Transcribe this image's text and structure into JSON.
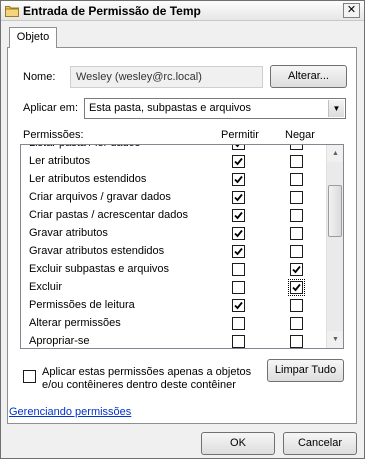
{
  "window": {
    "title": "Entrada de Permissão de Temp",
    "close_label": "✕"
  },
  "tabs": [
    {
      "label": "Objeto",
      "selected": true
    }
  ],
  "name": {
    "label": "Nome:",
    "value": "Wesley (wesley@rc.local)",
    "change_button": "Alterar..."
  },
  "apply_to": {
    "label": "Aplicar em:",
    "selected": "Esta pasta, subpastas e arquivos"
  },
  "permissions": {
    "header_label": "Permissões:",
    "allow_header": "Permitir",
    "deny_header": "Negar",
    "partial_top_row": "Listar pasta / ler dados",
    "rows": [
      {
        "label": "Ler atributos",
        "allow": true,
        "deny": false
      },
      {
        "label": "Ler atributos estendidos",
        "allow": true,
        "deny": false
      },
      {
        "label": "Criar arquivos / gravar dados",
        "allow": true,
        "deny": false
      },
      {
        "label": "Criar pastas / acrescentar dados",
        "allow": true,
        "deny": false
      },
      {
        "label": "Gravar atributos",
        "allow": true,
        "deny": false
      },
      {
        "label": "Gravar atributos estendidos",
        "allow": true,
        "deny": false
      },
      {
        "label": "Excluir subpastas e arquivos",
        "allow": false,
        "deny": true
      },
      {
        "label": "Excluir",
        "allow": false,
        "deny": true
      },
      {
        "label": "Permissões de leitura",
        "allow": true,
        "deny": false
      },
      {
        "label": "Alterar permissões",
        "allow": false,
        "deny": false
      },
      {
        "label": "Apropriar-se",
        "allow": false,
        "deny": false
      }
    ]
  },
  "apply_only": {
    "checked": false,
    "text": "Aplicar estas permissões apenas a objetos e/ou contêineres dentro deste contêiner"
  },
  "clear_all_button": "Limpar Tudo",
  "manage_link": "Gerenciando permissões",
  "footer": {
    "ok": "OK",
    "cancel": "Cancelar"
  },
  "colors": {
    "link": "#0033cc",
    "panel_bg": "#ffffff",
    "window_bg": "#f0f0f0"
  },
  "icons": {
    "title": "folder-icon",
    "combo": "chevron-down-icon",
    "scroll_up": "scroll-up-icon",
    "scroll_down": "scroll-down-icon"
  }
}
